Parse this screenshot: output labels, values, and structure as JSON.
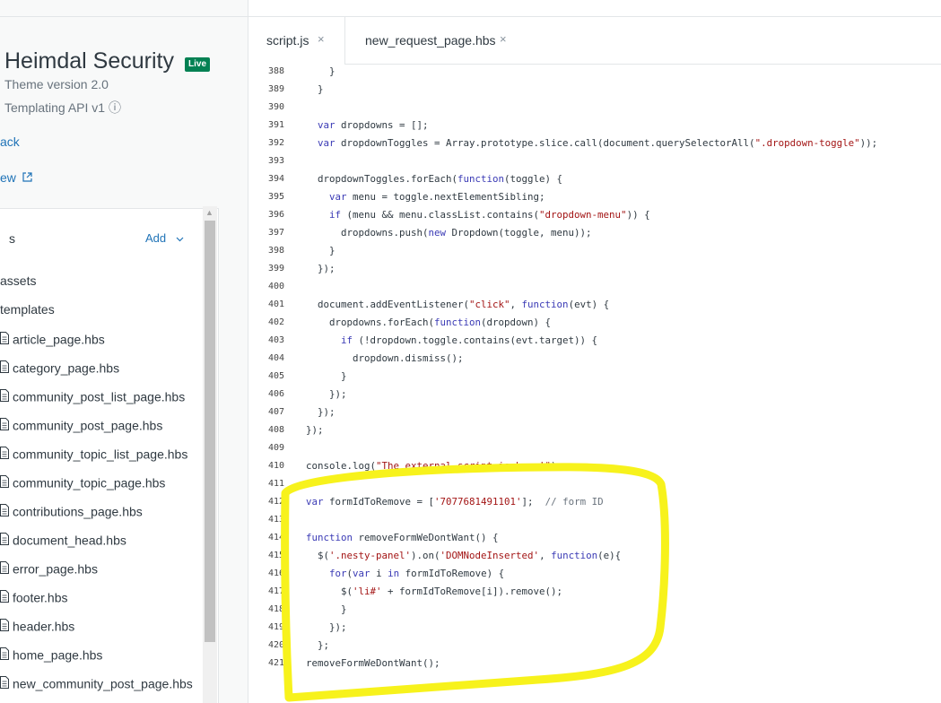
{
  "theme": {
    "name": "Heimdal Security",
    "badge": "Live",
    "version": "Theme version 2.0",
    "api": "Templating API v1 ⓘ",
    "back_link": "ack",
    "preview_link": "ew"
  },
  "files": {
    "header": "s",
    "add_label": "Add",
    "folders": [
      "assets",
      "templates"
    ],
    "items": [
      "article_page.hbs",
      "category_page.hbs",
      "community_post_list_page.hbs",
      "community_post_page.hbs",
      "community_topic_list_page.hbs",
      "community_topic_page.hbs",
      "contributions_page.hbs",
      "document_head.hbs",
      "error_page.hbs",
      "footer.hbs",
      "header.hbs",
      "home_page.hbs",
      "new_community_post_page.hbs"
    ]
  },
  "tabs": [
    {
      "label": "script.js",
      "close": "×"
    },
    {
      "label": "new_request_page.hbs",
      "close": "×"
    }
  ],
  "code": {
    "line_numbers": [
      "388",
      "389",
      "390",
      "391",
      "392",
      "393",
      "394",
      "395",
      "396",
      "397",
      "398",
      "399",
      "400",
      "401",
      "402",
      "403",
      "404",
      "405",
      "406",
      "407",
      "408",
      "409",
      "410",
      "411",
      "412",
      "413",
      "414",
      "415",
      "416",
      "417",
      "418",
      "419",
      "420",
      "421"
    ],
    "lines": [
      "    }",
      "  }",
      "",
      "  var dropdowns = [];",
      "  var dropdownToggles = Array.prototype.slice.call(document.querySelectorAll(\".dropdown-toggle\"));",
      "",
      "  dropdownToggles.forEach(function(toggle) {",
      "    var menu = toggle.nextElementSibling;",
      "    if (menu && menu.classList.contains(\"dropdown-menu\")) {",
      "      dropdowns.push(new Dropdown(toggle, menu));",
      "    }",
      "  });",
      "",
      "  document.addEventListener(\"click\", function(evt) {",
      "    dropdowns.forEach(function(dropdown) {",
      "      if (!dropdown.toggle.contains(evt.target)) {",
      "        dropdown.dismiss();",
      "      }",
      "    });",
      "  });",
      "});",
      "",
      "console.log(\"The external script is here!\");",
      "",
      "var formIdToRemove = ['7077681491101'];  // form ID",
      "",
      "function removeFormWeDontWant() {",
      "  $('.nesty-panel').on('DOMNodeInserted', function(e){",
      "    for(var i in formIdToRemove) {",
      "      $('li#' + formIdToRemove[i]).remove();",
      "      }",
      "    });",
      "  };",
      "removeFormWeDontWant();"
    ]
  },
  "colors": {
    "highlight": "#f7f21c",
    "accent": "#1f73b7",
    "live_badge": "#038153"
  }
}
